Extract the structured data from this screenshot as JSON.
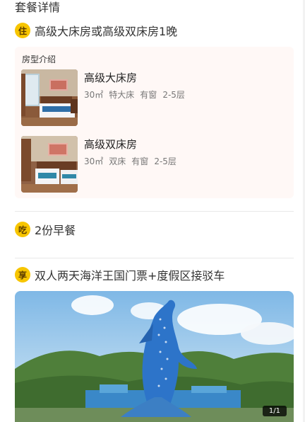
{
  "section": {
    "title": "套餐详情"
  },
  "room_package": {
    "badge": "住",
    "text": "高级大床房或高级双床房1晚",
    "box_title": "房型介绍",
    "rooms": [
      {
        "name": "高级大床房",
        "area": "30㎡",
        "bed": "特大床",
        "window": "有窗",
        "floor": "2-5层"
      },
      {
        "name": "高级双床房",
        "area": "30㎡",
        "bed": "双床",
        "window": "有窗",
        "floor": "2-5层"
      }
    ]
  },
  "meal_package": {
    "badge": "吃",
    "text": "2份早餐"
  },
  "fun_package": {
    "badge": "享",
    "text": "双人两天海洋王国门票+度假区接驳车",
    "photo_counter": "1/1"
  },
  "colors": {
    "badge": "#f7c500",
    "room_box_bg": "#fff8f6"
  }
}
